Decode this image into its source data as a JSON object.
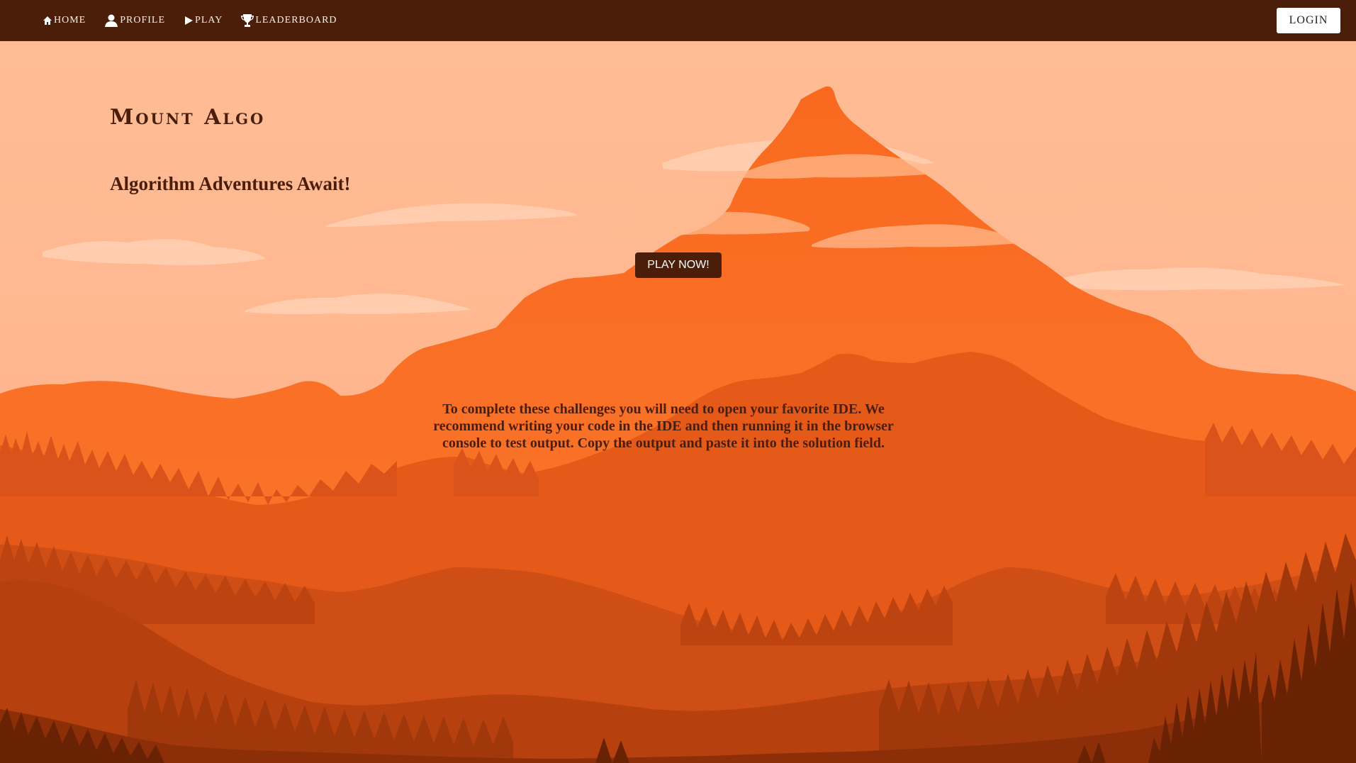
{
  "nav": {
    "items": [
      {
        "label": "HOME",
        "icon": "home-icon"
      },
      {
        "label": "PROFILE",
        "icon": "user-icon"
      },
      {
        "label": "PLAY",
        "icon": "play-icon"
      },
      {
        "label": "LEADERBOARD",
        "icon": "trophy-icon"
      }
    ],
    "login_label": "LOGIN"
  },
  "hero": {
    "title": "Mount Algo",
    "tagline": "Algorithm Adventures Await!",
    "play_label": "PLAY NOW!"
  },
  "instructions": "To complete these challenges you will need to open your favorite IDE. We recommend writing your code in the IDE and then running it in the browser console to test output. Copy the output and paste it into the solution field.",
  "colors": {
    "navbar": "#4b1e0a",
    "sky": "#ffbb93",
    "mountain": "#f96a20",
    "text_dark": "#4b1e0a"
  }
}
